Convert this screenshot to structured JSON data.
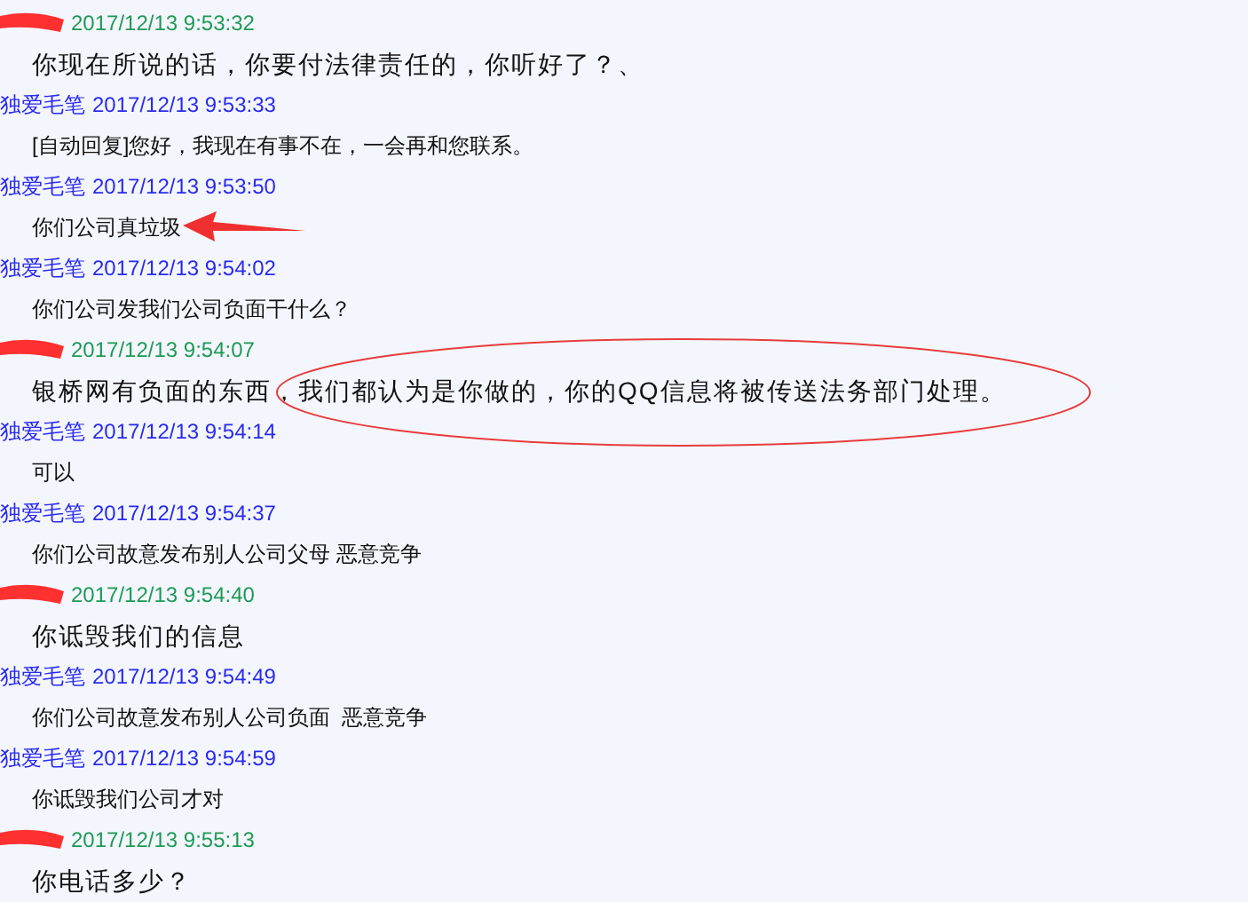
{
  "messages": [
    {
      "kind": "self",
      "time": "2017/12/13 9:53:32",
      "text": "你现在所说的话，你要付法律责任的，你听好了？、",
      "arrowed": false,
      "circled": false
    },
    {
      "kind": "other",
      "sender": "独爱毛笔",
      "time": "2017/12/13 9:53:33",
      "text": "[自动回复]您好，我现在有事不在，一会再和您联系。",
      "arrowed": false,
      "circled": false
    },
    {
      "kind": "other",
      "sender": "独爱毛笔",
      "time": "2017/12/13 9:53:50",
      "text": "你们公司真垃圾",
      "arrowed": true,
      "circled": false
    },
    {
      "kind": "other",
      "sender": "独爱毛笔",
      "time": "2017/12/13 9:54:02",
      "text": "你们公司发我们公司负面干什么？",
      "arrowed": false,
      "circled": false
    },
    {
      "kind": "self",
      "time": "2017/12/13 9:54:07",
      "text": "银桥网有负面的东西，我们都认为是你做的，你的QQ信息将被传送法务部门处理。",
      "arrowed": false,
      "circled": true
    },
    {
      "kind": "other",
      "sender": "独爱毛笔",
      "time": "2017/12/13 9:54:14",
      "text": "可以",
      "arrowed": false,
      "circled": false
    },
    {
      "kind": "other",
      "sender": "独爱毛笔",
      "time": "2017/12/13 9:54:37",
      "text": "你们公司故意发布别人公司父母 恶意竞争",
      "arrowed": false,
      "circled": false
    },
    {
      "kind": "self",
      "time": "2017/12/13 9:54:40",
      "text": "你诋毁我们的信息",
      "arrowed": false,
      "circled": false
    },
    {
      "kind": "other",
      "sender": "独爱毛笔",
      "time": "2017/12/13 9:54:49",
      "text": "你们公司故意发布别人公司负面  恶意竞争",
      "arrowed": false,
      "circled": false
    },
    {
      "kind": "other",
      "sender": "独爱毛笔",
      "time": "2017/12/13 9:54:59",
      "text": "你诋毁我们公司才对",
      "arrowed": false,
      "circled": false
    },
    {
      "kind": "self",
      "time": "2017/12/13 9:55:13",
      "text": "你电话多少？",
      "arrowed": false,
      "circled": false
    }
  ]
}
